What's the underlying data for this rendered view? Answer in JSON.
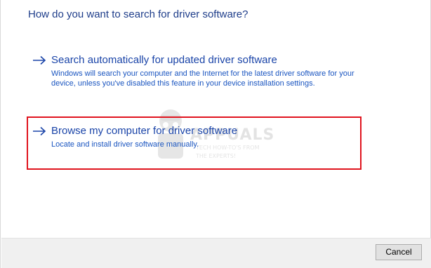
{
  "dialog": {
    "heading": "How do you want to search for driver software?"
  },
  "options": [
    {
      "icon": "arrow-right-icon",
      "title": "Search automatically for updated driver software",
      "description": "Windows will search your computer and the Internet for the latest driver software for your device, unless you've disabled this feature in your device installation settings."
    },
    {
      "icon": "arrow-right-icon",
      "title": "Browse my computer for driver software",
      "description": "Locate and install driver software manually."
    }
  ],
  "watermark": {
    "brand": "APPUALS",
    "tagline_1": "TECH HOW-TO'S FROM",
    "tagline_2": "THE EXPERTS!"
  },
  "footer": {
    "cancel_label": "Cancel"
  },
  "colors": {
    "heading": "#1e3d8a",
    "link": "#1a44a8",
    "highlight_border": "#e0141e",
    "footer_bg": "#f0f0f0"
  }
}
